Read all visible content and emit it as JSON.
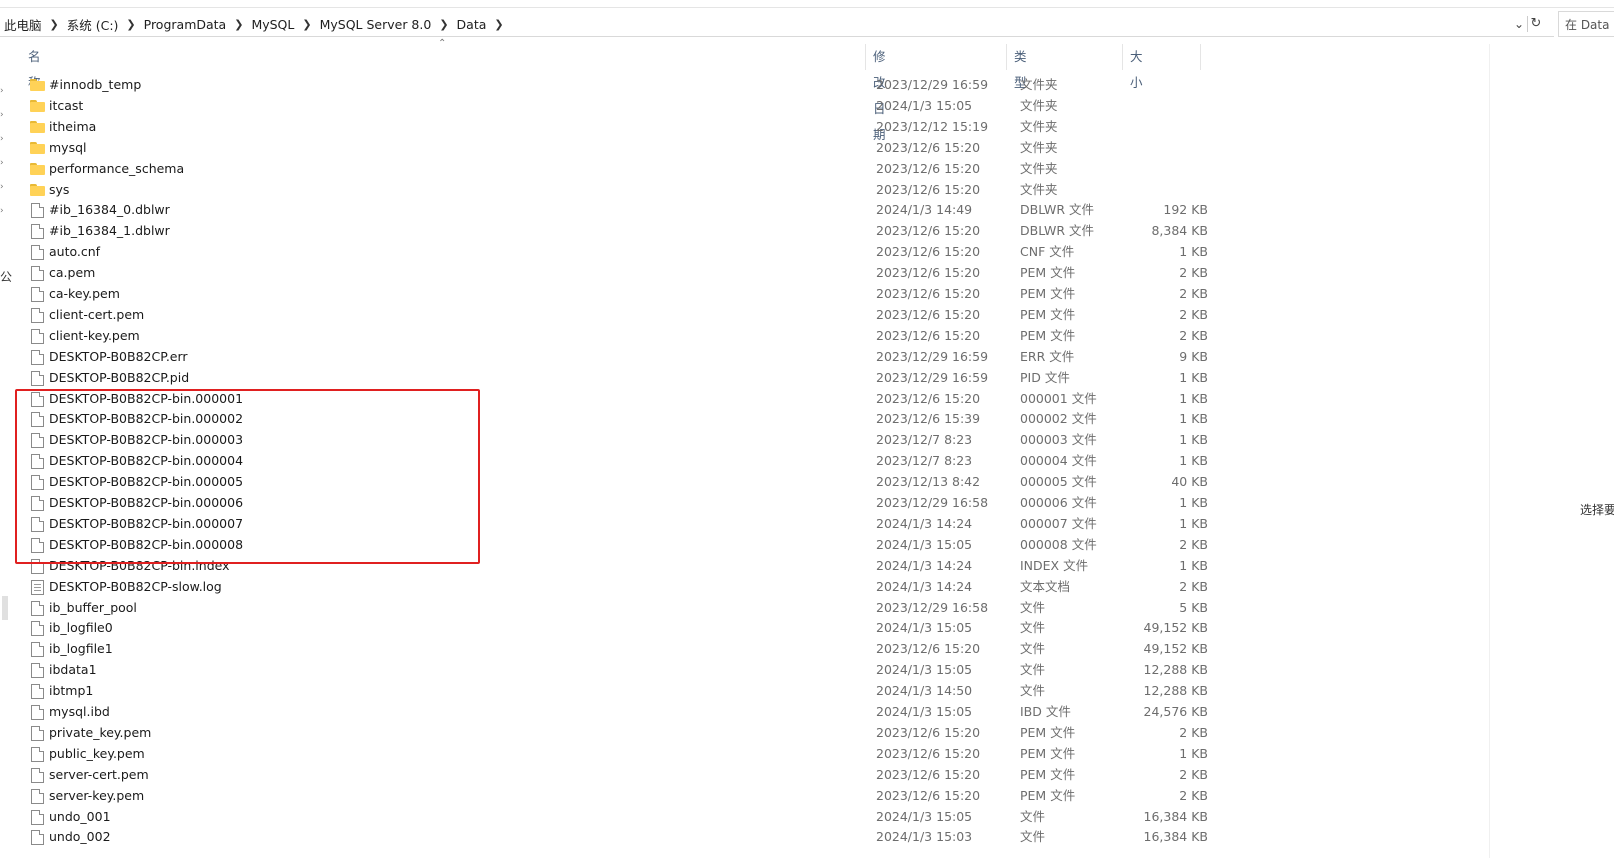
{
  "breadcrumb": [
    "此电脑",
    "系统 (C:)",
    "ProgramData",
    "MySQL",
    "MySQL Server 8.0",
    "Data"
  ],
  "search": {
    "placeholder": "在 Data"
  },
  "nav": {
    "partial_char": "公"
  },
  "columns": {
    "name": "名称",
    "date": "修改日期",
    "type": "类型",
    "size": "大小"
  },
  "side_note": "选择要",
  "files": [
    {
      "name": "#innodb_temp",
      "date": "2023/12/29 16:59",
      "type": "文件夹",
      "size": "",
      "icon": "folder-icon"
    },
    {
      "name": "itcast",
      "date": "2024/1/3 15:05",
      "type": "文件夹",
      "size": "",
      "icon": "folder-icon"
    },
    {
      "name": "itheima",
      "date": "2023/12/12 15:19",
      "type": "文件夹",
      "size": "",
      "icon": "folder-icon"
    },
    {
      "name": "mysql",
      "date": "2023/12/6 15:20",
      "type": "文件夹",
      "size": "",
      "icon": "folder-icon"
    },
    {
      "name": "performance_schema",
      "date": "2023/12/6 15:20",
      "type": "文件夹",
      "size": "",
      "icon": "folder-icon"
    },
    {
      "name": "sys",
      "date": "2023/12/6 15:20",
      "type": "文件夹",
      "size": "",
      "icon": "folder-icon"
    },
    {
      "name": "#ib_16384_0.dblwr",
      "date": "2024/1/3 14:49",
      "type": "DBLWR 文件",
      "size": "192 KB",
      "icon": "file-icon"
    },
    {
      "name": "#ib_16384_1.dblwr",
      "date": "2023/12/6 15:20",
      "type": "DBLWR 文件",
      "size": "8,384 KB",
      "icon": "file-icon"
    },
    {
      "name": "auto.cnf",
      "date": "2023/12/6 15:20",
      "type": "CNF 文件",
      "size": "1 KB",
      "icon": "file-icon"
    },
    {
      "name": "ca.pem",
      "date": "2023/12/6 15:20",
      "type": "PEM 文件",
      "size": "2 KB",
      "icon": "file-icon"
    },
    {
      "name": "ca-key.pem",
      "date": "2023/12/6 15:20",
      "type": "PEM 文件",
      "size": "2 KB",
      "icon": "file-icon"
    },
    {
      "name": "client-cert.pem",
      "date": "2023/12/6 15:20",
      "type": "PEM 文件",
      "size": "2 KB",
      "icon": "file-icon"
    },
    {
      "name": "client-key.pem",
      "date": "2023/12/6 15:20",
      "type": "PEM 文件",
      "size": "2 KB",
      "icon": "file-icon"
    },
    {
      "name": "DESKTOP-B0B82CP.err",
      "date": "2023/12/29 16:59",
      "type": "ERR 文件",
      "size": "9 KB",
      "icon": "file-icon"
    },
    {
      "name": "DESKTOP-B0B82CP.pid",
      "date": "2023/12/29 16:59",
      "type": "PID 文件",
      "size": "1 KB",
      "icon": "file-icon"
    },
    {
      "name": "DESKTOP-B0B82CP-bin.000001",
      "date": "2023/12/6 15:20",
      "type": "000001 文件",
      "size": "1 KB",
      "icon": "file-icon"
    },
    {
      "name": "DESKTOP-B0B82CP-bin.000002",
      "date": "2023/12/6 15:39",
      "type": "000002 文件",
      "size": "1 KB",
      "icon": "file-icon"
    },
    {
      "name": "DESKTOP-B0B82CP-bin.000003",
      "date": "2023/12/7 8:23",
      "type": "000003 文件",
      "size": "1 KB",
      "icon": "file-icon"
    },
    {
      "name": "DESKTOP-B0B82CP-bin.000004",
      "date": "2023/12/7 8:23",
      "type": "000004 文件",
      "size": "1 KB",
      "icon": "file-icon"
    },
    {
      "name": "DESKTOP-B0B82CP-bin.000005",
      "date": "2023/12/13 8:42",
      "type": "000005 文件",
      "size": "40 KB",
      "icon": "file-icon"
    },
    {
      "name": "DESKTOP-B0B82CP-bin.000006",
      "date": "2023/12/29 16:58",
      "type": "000006 文件",
      "size": "1 KB",
      "icon": "file-icon"
    },
    {
      "name": "DESKTOP-B0B82CP-bin.000007",
      "date": "2024/1/3 14:24",
      "type": "000007 文件",
      "size": "1 KB",
      "icon": "file-icon"
    },
    {
      "name": "DESKTOP-B0B82CP-bin.000008",
      "date": "2024/1/3 15:05",
      "type": "000008 文件",
      "size": "2 KB",
      "icon": "file-icon"
    },
    {
      "name": "DESKTOP-B0B82CP-bin.index",
      "date": "2024/1/3 14:24",
      "type": "INDEX 文件",
      "size": "1 KB",
      "icon": "file-icon"
    },
    {
      "name": "DESKTOP-B0B82CP-slow.log",
      "date": "2024/1/3 14:24",
      "type": "文本文档",
      "size": "2 KB",
      "icon": "text-file-icon"
    },
    {
      "name": "ib_buffer_pool",
      "date": "2023/12/29 16:58",
      "type": "文件",
      "size": "5 KB",
      "icon": "file-icon"
    },
    {
      "name": "ib_logfile0",
      "date": "2024/1/3 15:05",
      "type": "文件",
      "size": "49,152 KB",
      "icon": "file-icon"
    },
    {
      "name": "ib_logfile1",
      "date": "2023/12/6 15:20",
      "type": "文件",
      "size": "49,152 KB",
      "icon": "file-icon"
    },
    {
      "name": "ibdata1",
      "date": "2024/1/3 15:05",
      "type": "文件",
      "size": "12,288 KB",
      "icon": "file-icon"
    },
    {
      "name": "ibtmp1",
      "date": "2024/1/3 14:50",
      "type": "文件",
      "size": "12,288 KB",
      "icon": "file-icon"
    },
    {
      "name": "mysql.ibd",
      "date": "2024/1/3 15:05",
      "type": "IBD 文件",
      "size": "24,576 KB",
      "icon": "file-icon"
    },
    {
      "name": "private_key.pem",
      "date": "2023/12/6 15:20",
      "type": "PEM 文件",
      "size": "2 KB",
      "icon": "file-icon"
    },
    {
      "name": "public_key.pem",
      "date": "2023/12/6 15:20",
      "type": "PEM 文件",
      "size": "1 KB",
      "icon": "file-icon"
    },
    {
      "name": "server-cert.pem",
      "date": "2023/12/6 15:20",
      "type": "PEM 文件",
      "size": "2 KB",
      "icon": "file-icon"
    },
    {
      "name": "server-key.pem",
      "date": "2023/12/6 15:20",
      "type": "PEM 文件",
      "size": "2 KB",
      "icon": "file-icon"
    },
    {
      "name": "undo_001",
      "date": "2024/1/3 15:05",
      "type": "文件",
      "size": "16,384 KB",
      "icon": "file-icon"
    },
    {
      "name": "undo_002",
      "date": "2024/1/3 15:03",
      "type": "文件",
      "size": "16,384 KB",
      "icon": "file-icon"
    }
  ],
  "annotation": {
    "color": "#e02020",
    "highlighted_files": [
      "DESKTOP-B0B82CP-bin.000001",
      "DESKTOP-B0B82CP-bin.000002",
      "DESKTOP-B0B82CP-bin.000003",
      "DESKTOP-B0B82CP-bin.000004",
      "DESKTOP-B0B82CP-bin.000005",
      "DESKTOP-B0B82CP-bin.000006",
      "DESKTOP-B0B82CP-bin.000007",
      "DESKTOP-B0B82CP-bin.000008"
    ]
  }
}
